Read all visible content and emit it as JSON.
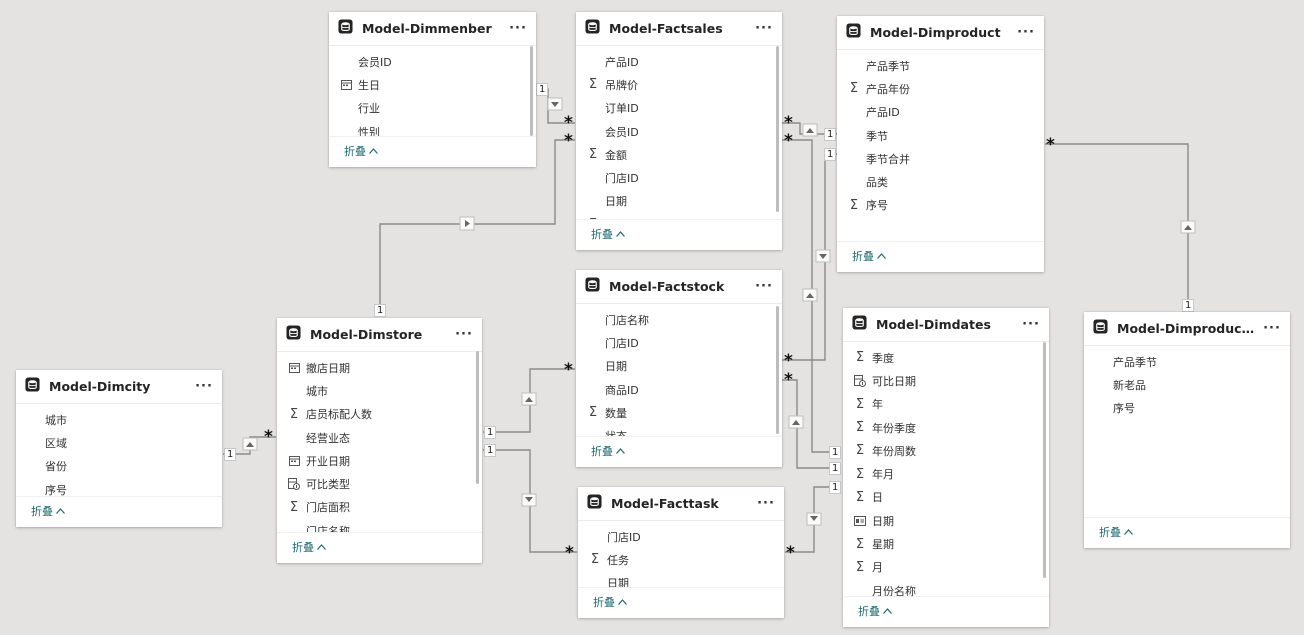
{
  "tables": {
    "dimmenber": {
      "title": "Model-Dimmenber",
      "fields": [
        {
          "name": "会员ID",
          "icon": "none"
        },
        {
          "name": "生日",
          "icon": "calendar-icon"
        },
        {
          "name": "行业",
          "icon": "none"
        },
        {
          "name": "性别",
          "icon": "none"
        }
      ],
      "collapse": "折叠"
    },
    "factsales": {
      "title": "Model-Factsales",
      "fields": [
        {
          "name": "产品ID",
          "icon": "none"
        },
        {
          "name": "吊牌价",
          "icon": "sigma-icon"
        },
        {
          "name": "订单ID",
          "icon": "none"
        },
        {
          "name": "会员ID",
          "icon": "none"
        },
        {
          "name": "金额",
          "icon": "sigma-icon"
        },
        {
          "name": "门店ID",
          "icon": "none"
        },
        {
          "name": "日期",
          "icon": "none"
        },
        {
          "name": "数量",
          "icon": "sigma-icon"
        }
      ],
      "collapse": "折叠"
    },
    "dimproduct": {
      "title": "Model-Dimproduct",
      "fields": [
        {
          "name": "产品季节",
          "icon": "none"
        },
        {
          "name": "产品年份",
          "icon": "sigma-icon"
        },
        {
          "name": "产品ID",
          "icon": "none"
        },
        {
          "name": "季节",
          "icon": "none"
        },
        {
          "name": "季节合并",
          "icon": "none"
        },
        {
          "name": "品类",
          "icon": "none"
        },
        {
          "name": "序号",
          "icon": "sigma-icon"
        }
      ],
      "collapse": "折叠"
    },
    "factstock": {
      "title": "Model-Factstock",
      "fields": [
        {
          "name": "门店名称",
          "icon": "none"
        },
        {
          "name": "门店ID",
          "icon": "none"
        },
        {
          "name": "日期",
          "icon": "none"
        },
        {
          "name": "商品ID",
          "icon": "none"
        },
        {
          "name": "数量",
          "icon": "sigma-icon"
        },
        {
          "name": "状态",
          "icon": "none"
        }
      ],
      "collapse": "折叠"
    },
    "dimstore": {
      "title": "Model-Dimstore",
      "fields": [
        {
          "name": "撤店日期",
          "icon": "calendar-icon"
        },
        {
          "name": "城市",
          "icon": "none"
        },
        {
          "name": "店员标配人数",
          "icon": "sigma-icon"
        },
        {
          "name": "经营业态",
          "icon": "none"
        },
        {
          "name": "开业日期",
          "icon": "calendar-icon"
        },
        {
          "name": "可比类型",
          "icon": "calc-column-icon"
        },
        {
          "name": "门店面积",
          "icon": "sigma-icon"
        },
        {
          "name": "门店名称",
          "icon": "none"
        }
      ],
      "collapse": "折叠"
    },
    "dimcity": {
      "title": "Model-Dimcity",
      "fields": [
        {
          "name": "城市",
          "icon": "none"
        },
        {
          "name": "区域",
          "icon": "none"
        },
        {
          "name": "省份",
          "icon": "none"
        },
        {
          "name": "序号",
          "icon": "none"
        }
      ],
      "collapse": "折叠"
    },
    "facttask": {
      "title": "Model-Facttask",
      "fields": [
        {
          "name": "门店ID",
          "icon": "none"
        },
        {
          "name": "任务",
          "icon": "sigma-icon"
        },
        {
          "name": "日期",
          "icon": "none"
        }
      ],
      "collapse": "折叠"
    },
    "dimdates": {
      "title": "Model-Dimdates",
      "fields": [
        {
          "name": "季度",
          "icon": "sigma-icon"
        },
        {
          "name": "可比日期",
          "icon": "calc-column-icon"
        },
        {
          "name": "年",
          "icon": "sigma-icon"
        },
        {
          "name": "年份季度",
          "icon": "sigma-icon"
        },
        {
          "name": "年份周数",
          "icon": "sigma-icon"
        },
        {
          "name": "年月",
          "icon": "sigma-icon"
        },
        {
          "name": "日",
          "icon": "sigma-icon"
        },
        {
          "name": "日期",
          "icon": "date-hierarchy-icon"
        },
        {
          "name": "星期",
          "icon": "sigma-icon"
        },
        {
          "name": "月",
          "icon": "sigma-icon"
        },
        {
          "name": "月份名称",
          "icon": "none"
        }
      ],
      "collapse": "折叠"
    },
    "dimproductseason": {
      "title": "Model-Dimproductseas...",
      "fields": [
        {
          "name": "产品季节",
          "icon": "none"
        },
        {
          "name": "新老品",
          "icon": "none"
        },
        {
          "name": "序号",
          "icon": "none"
        }
      ],
      "collapse": "折叠"
    }
  },
  "ui": {
    "more_label": "···",
    "collapse_chevron": "^",
    "one_label": "1",
    "many_label": "*"
  },
  "colors": {
    "canvas": "#e4e3e1",
    "line": "#8a8886",
    "collapse_text": "#1e6a6f"
  }
}
